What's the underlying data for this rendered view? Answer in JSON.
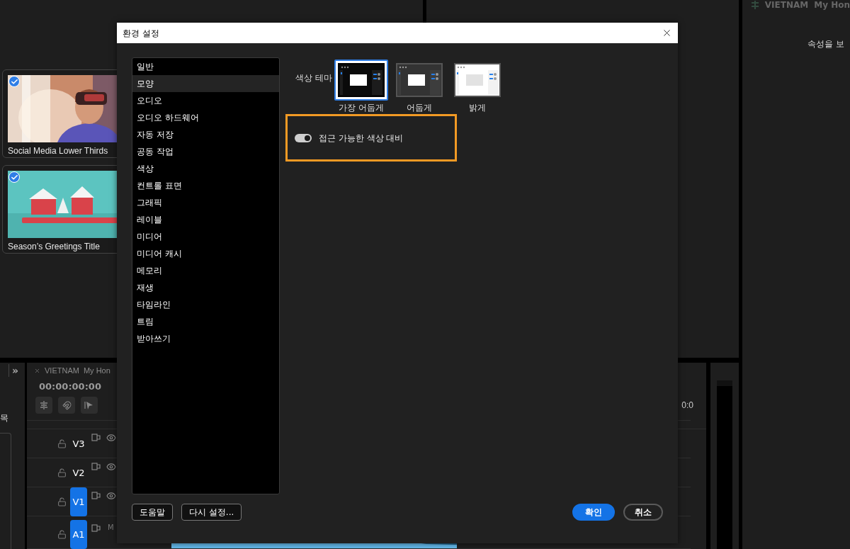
{
  "templates_panel": {
    "cards": [
      {
        "title": "Social Media Lower Thirds",
        "checked": true,
        "kind": "portrait"
      },
      {
        "title": "Season’s Greetings Title",
        "checked": true,
        "kind": "winter"
      }
    ]
  },
  "properties_panel": {
    "tabs": [
      "VIETNAM",
      "My Hon"
    ],
    "message": "속성을 보"
  },
  "side_panel": {
    "expand": "»",
    "label": "목"
  },
  "timeline": {
    "tabs": [
      "VIETNAM",
      "My Hon"
    ],
    "timecode": "00:00:00:00",
    "end_time": "0:0",
    "tracks": [
      {
        "name": "V3",
        "targeted": false,
        "kind": "video"
      },
      {
        "name": "V2",
        "targeted": false,
        "kind": "video"
      },
      {
        "name": "V1",
        "targeted": true,
        "kind": "video"
      },
      {
        "name": "A1",
        "targeted": true,
        "kind": "audio",
        "button": "M"
      }
    ]
  },
  "dialog": {
    "title": "환경 설정",
    "categories": [
      {
        "label": "일반",
        "selected": false
      },
      {
        "label": "모양",
        "selected": true
      },
      {
        "label": "오디오",
        "selected": false
      },
      {
        "label": "오디오 하드웨어",
        "selected": false
      },
      {
        "label": "자동 저장",
        "selected": false
      },
      {
        "label": "공동 작업",
        "selected": false
      },
      {
        "label": "색상",
        "selected": false
      },
      {
        "label": "컨트롤 표면",
        "selected": false
      },
      {
        "label": "그래픽",
        "selected": false
      },
      {
        "label": "레이블",
        "selected": false
      },
      {
        "label": "미디어",
        "selected": false
      },
      {
        "label": "미디어 캐시",
        "selected": false
      },
      {
        "label": "메모리",
        "selected": false
      },
      {
        "label": "재생",
        "selected": false
      },
      {
        "label": "타임라인",
        "selected": false
      },
      {
        "label": "트림",
        "selected": false
      },
      {
        "label": "받아쓰기",
        "selected": false
      }
    ],
    "color_theme": {
      "label": "색상 테마",
      "options": [
        {
          "label": "가장 어둡게",
          "selected": true,
          "kind": "darkest"
        },
        {
          "label": "어둡게",
          "selected": false,
          "kind": "dark"
        },
        {
          "label": "밝게",
          "selected": false,
          "kind": "light"
        }
      ]
    },
    "contrast_toggle": {
      "label": "접근 가능한 색상 대비",
      "on": true
    },
    "buttons": [
      {
        "label": "도움말",
        "kind": "secondary"
      },
      {
        "label": "다시 설정...",
        "kind": "secondary"
      },
      {
        "label": "확인",
        "kind": "primary"
      },
      {
        "label": "취소",
        "kind": "cancel"
      }
    ]
  }
}
